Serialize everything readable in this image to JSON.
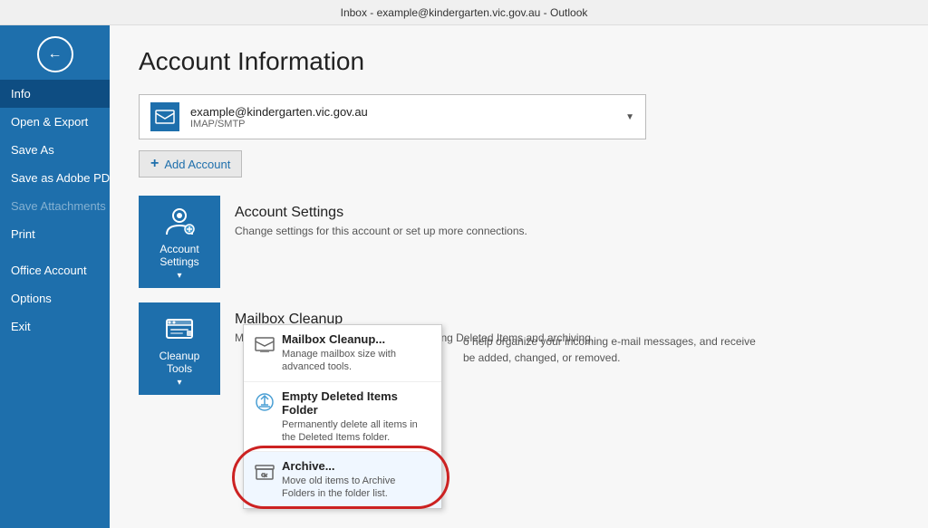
{
  "titlebar": {
    "text": "Inbox - example@kindergarten.vic.gov.au - Outlook"
  },
  "sidebar": {
    "back_label": "←",
    "items": [
      {
        "id": "info",
        "label": "Info",
        "active": true,
        "disabled": false
      },
      {
        "id": "open-export",
        "label": "Open & Export",
        "active": false,
        "disabled": false
      },
      {
        "id": "save-as",
        "label": "Save As",
        "active": false,
        "disabled": false
      },
      {
        "id": "save-adobe",
        "label": "Save as Adobe PDF",
        "active": false,
        "disabled": false
      },
      {
        "id": "save-attachments",
        "label": "Save Attachments",
        "active": false,
        "disabled": true
      },
      {
        "id": "print",
        "label": "Print",
        "active": false,
        "disabled": false
      },
      {
        "id": "office-account",
        "label": "Office Account",
        "active": false,
        "disabled": false
      },
      {
        "id": "options",
        "label": "Options",
        "active": false,
        "disabled": false
      },
      {
        "id": "exit",
        "label": "Exit",
        "active": false,
        "disabled": false
      }
    ]
  },
  "main": {
    "page_title": "Account Information",
    "account": {
      "email": "example@kindergarten.vic.gov.au",
      "type": "IMAP/SMTP"
    },
    "add_account_label": "Add Account",
    "account_settings": {
      "card_label": "Account Settings",
      "card_arrow": "▾",
      "title": "Account Settings",
      "description": "Change settings for this account or set up more connections."
    },
    "cleanup_tools": {
      "card_label": "Cleanup Tools",
      "card_arrow": "▾",
      "title": "Mailbox Cleanup",
      "description": "Manage the size of your mailbox by emptying Deleted Items and archiving."
    },
    "connected_services": {
      "description_line1": "o help organize your incoming e-mail messages, and receive",
      "description_line2": "be added, changed, or removed."
    }
  },
  "dropdown": {
    "items": [
      {
        "id": "mailbox-cleanup",
        "title": "Mailbox Cleanup...",
        "description": "Manage mailbox size with advanced tools.",
        "icon": "📦"
      },
      {
        "id": "empty-deleted",
        "title": "Empty Deleted Items Folder",
        "description": "Permanently delete all items in the Deleted Items folder.",
        "icon": "🗑"
      },
      {
        "id": "archive",
        "title": "Archive...",
        "description": "Move old items to Archive Folders in the folder list.",
        "icon": "📁",
        "highlighted": true
      }
    ]
  },
  "icons": {
    "back": "←",
    "account_selector_icon": "✉",
    "account_settings_icon": "⚙",
    "cleanup_icon": "🖥",
    "mailbox_icon": "📦",
    "trash_icon": "♻",
    "archive_icon": "📁",
    "plus": "+"
  }
}
